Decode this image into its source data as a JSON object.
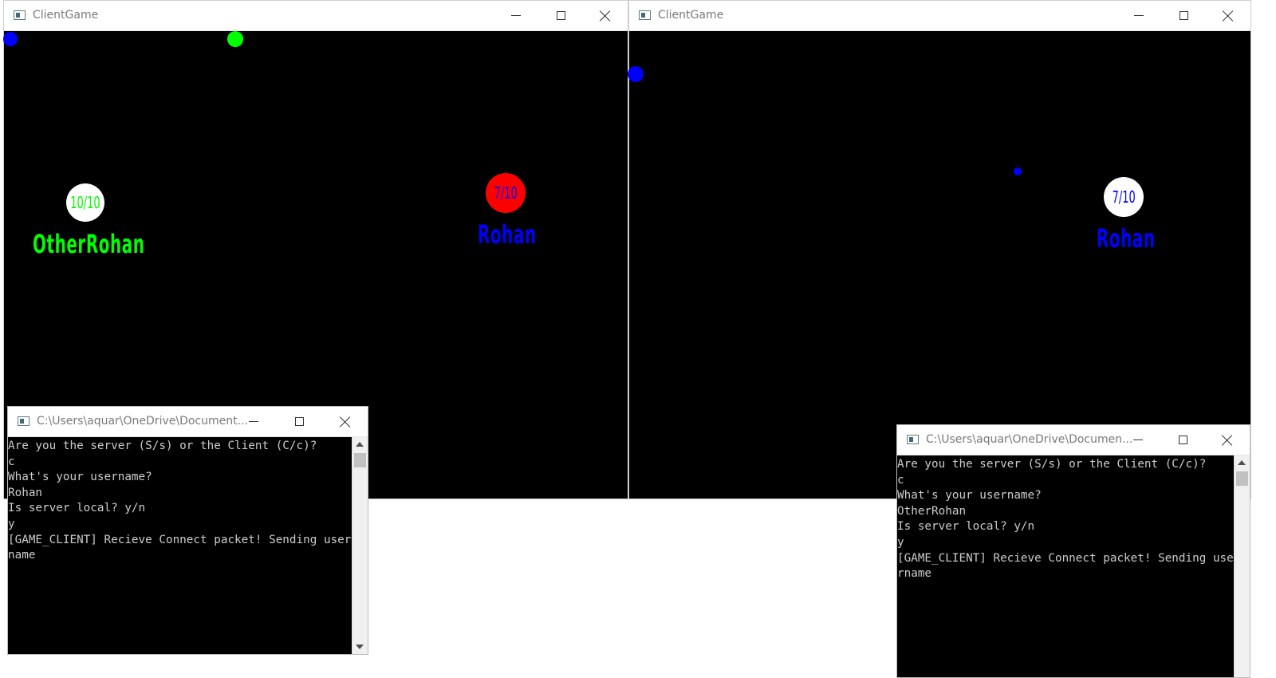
{
  "game_window_left": {
    "title": "ClientGame",
    "players": [
      {
        "hp": "10/10",
        "name": "OtherRohan",
        "badge_bg": "#ffffff",
        "hp_color": "#00ff00",
        "name_color": "#00ff00"
      },
      {
        "hp": "7/10",
        "name": "Rohan",
        "badge_bg": "#ff0000",
        "hp_color": "#0000ff",
        "name_color": "#0000ff"
      }
    ]
  },
  "game_window_right": {
    "title": "ClientGame",
    "players": [
      {
        "hp": "7/10",
        "name": "Rohan",
        "badge_bg": "#ffffff",
        "hp_color": "#0000ff",
        "name_color": "#0000ff"
      }
    ]
  },
  "console_left": {
    "title": "C:\\Users\\aquar\\OneDrive\\Document...",
    "output": "Are you the server (S/s) or the Client (C/c)?\nc\nWhat's your username?\nRohan\nIs server local? y/n\ny\n[GAME_CLIENT] Recieve Connect packet! Sending username"
  },
  "console_right": {
    "title": "C:\\Users\\aquar\\OneDrive\\Documen...",
    "output": "Are you the server (S/s) or the Client (C/c)?\nc\nWhat's your username?\nOtherRohan\nIs server local? y/n\ny\n[GAME_CLIENT] Recieve Connect packet! Sending username"
  },
  "colors": {
    "green": "#00ff00",
    "blue": "#0000ff",
    "red": "#ff0000"
  },
  "icons": [
    "app-icon",
    "minimize-icon",
    "maximize-icon",
    "close-icon",
    "scroll-up-icon",
    "scroll-down-icon"
  ]
}
